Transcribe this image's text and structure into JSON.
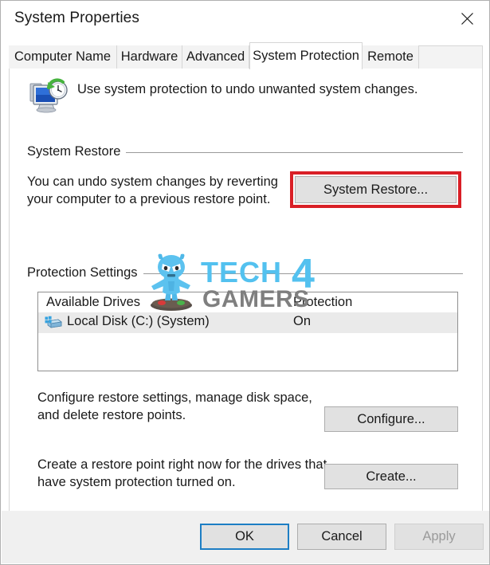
{
  "window": {
    "title": "System Properties",
    "close_icon": "close-icon"
  },
  "tabs": [
    {
      "label": "Computer Name",
      "active": false
    },
    {
      "label": "Hardware",
      "active": false
    },
    {
      "label": "Advanced",
      "active": false
    },
    {
      "label": "System Protection",
      "active": true
    },
    {
      "label": "Remote",
      "active": false
    }
  ],
  "header": {
    "icon": "system-protection-icon",
    "text": "Use system protection to undo unwanted system changes."
  },
  "system_restore": {
    "group_label": "System Restore",
    "description_line1": "You can undo system changes by reverting",
    "description_line2": "your computer to a previous restore point.",
    "button_label": "System Restore...",
    "highlight_color": "#d91f26"
  },
  "protection_settings": {
    "group_label": "Protection Settings",
    "columns": [
      "Available Drives",
      "Protection"
    ],
    "rows": [
      {
        "icon": "hard-drive-icon",
        "drive": "Local Disk (C:) (System)",
        "protection": "On",
        "selected": true
      }
    ],
    "configure": {
      "description_line1": "Configure restore settings, manage disk space,",
      "description_line2": "and delete restore points.",
      "button_label": "Configure..."
    },
    "create": {
      "description_line1": "Create a restore point right now for the drives that",
      "description_line2": "have system protection turned on.",
      "button_label": "Create..."
    }
  },
  "command_bar": {
    "ok_label": "OK",
    "cancel_label": "Cancel",
    "apply_label": "Apply",
    "apply_disabled": true,
    "focus_color": "#1d7ec4"
  },
  "watermark": {
    "text_primary": "TECH",
    "text_number": "4",
    "text_secondary": "GAMERS",
    "color_primary": "#53c1ef",
    "color_secondary": "#7f7f7f",
    "mascot": "tech4gamers-mascot-icon"
  }
}
